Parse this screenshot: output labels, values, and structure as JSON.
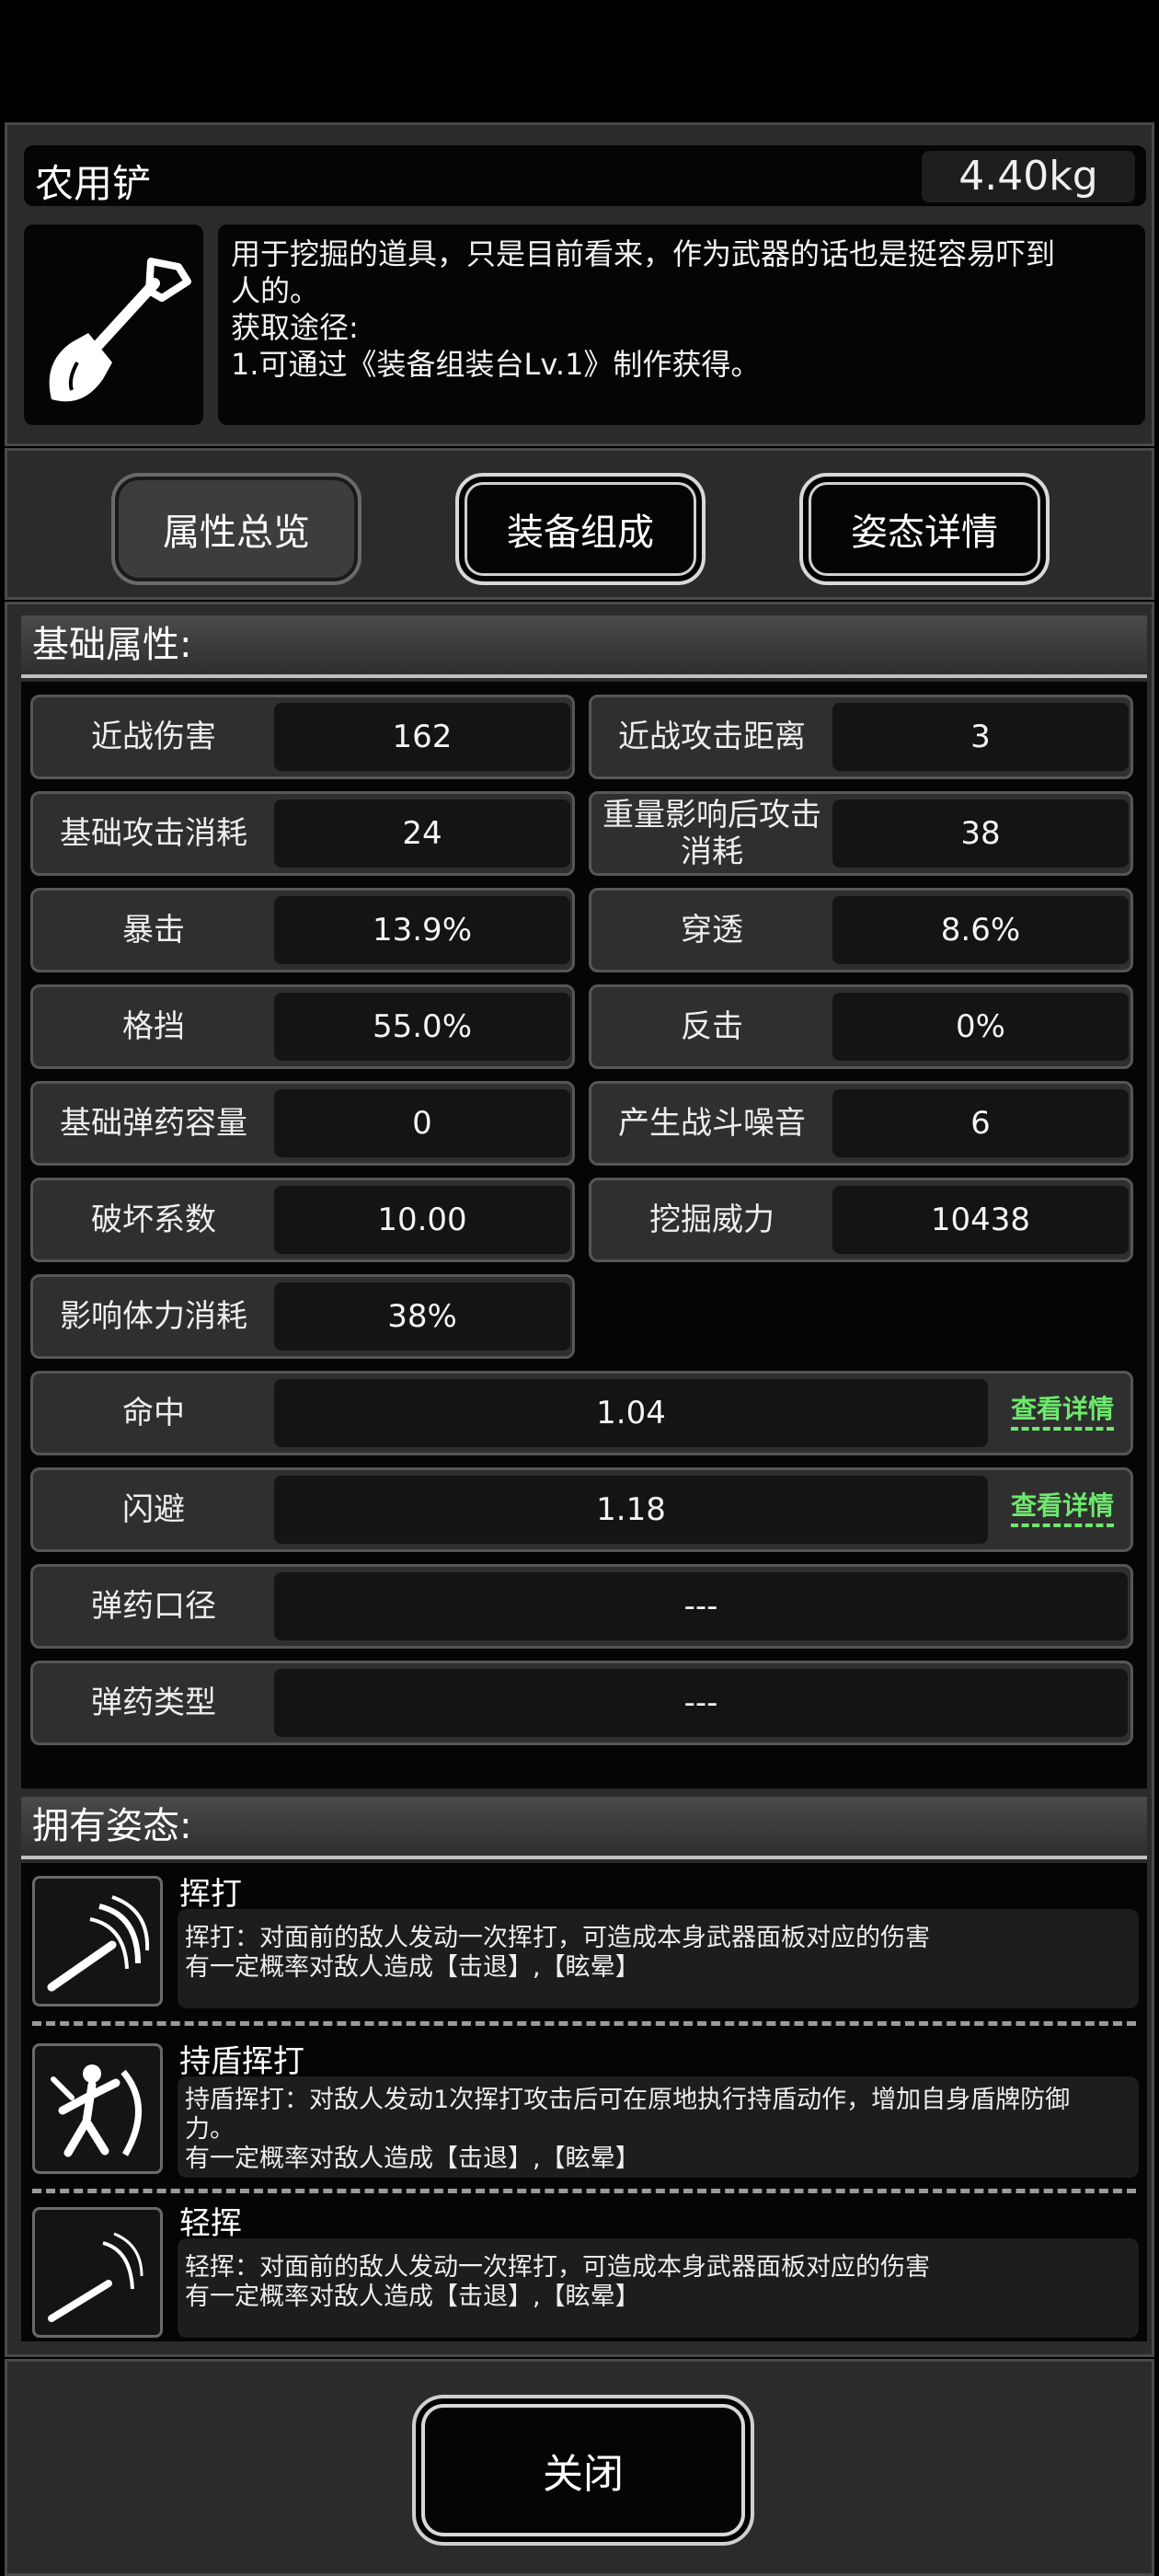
{
  "item": {
    "name": "农用铲",
    "weight": "4.40kg",
    "icon": "shovel-icon",
    "description_lines": [
      "用于挖掘的道具，只是目前看来，作为武器的话也是挺容易吓到",
      "人的。",
      "获取途径:",
      "1.可通过《装备组装台Lv.1》制作获得。"
    ]
  },
  "tabs": [
    {
      "label": "属性总览",
      "active": true
    },
    {
      "label": "装备组成",
      "active": false
    },
    {
      "label": "姿态详情",
      "active": false
    }
  ],
  "base_stats": {
    "heading": "基础属性:",
    "grid": [
      {
        "label": "近战伤害",
        "value": "162"
      },
      {
        "label": "近战攻击距离",
        "value": "3"
      },
      {
        "label": "基础攻击消耗",
        "value": "24"
      },
      {
        "label": "重量影响后攻击消耗",
        "value": "38"
      },
      {
        "label": "暴击",
        "value": "13.9%"
      },
      {
        "label": "穿透",
        "value": "8.6%"
      },
      {
        "label": "格挡",
        "value": "55.0%"
      },
      {
        "label": "反击",
        "value": "0%"
      },
      {
        "label": "基础弹药容量",
        "value": "0"
      },
      {
        "label": "产生战斗噪音",
        "value": "6"
      },
      {
        "label": "破坏系数",
        "value": "10.00"
      },
      {
        "label": "挖掘威力",
        "value": "10438"
      },
      {
        "label": "影响体力消耗",
        "value": "38%"
      }
    ],
    "wide": [
      {
        "label": "命中",
        "value": "1.04",
        "link": "查看详情"
      },
      {
        "label": "闪避",
        "value": "1.18",
        "link": "查看详情"
      },
      {
        "label": "弹药口径",
        "value": "---"
      },
      {
        "label": "弹药类型",
        "value": "---"
      }
    ]
  },
  "poses": {
    "heading": "拥有姿态:",
    "items": [
      {
        "name": "挥打",
        "icon": "swing-icon",
        "lines": [
          "挥打：对面前的敌人发动一次挥打，可造成本身武器面板对应的伤害",
          "有一定概率对敌人造成【击退】,【眩晕】"
        ]
      },
      {
        "name": "持盾挥打",
        "icon": "shield-swing-icon",
        "lines": [
          "持盾挥打：对敌人发动1次挥打攻击后可在原地执行持盾动作，增加自身盾牌防御",
          "力。",
          "有一定概率对敌人造成【击退】,【眩晕】"
        ]
      },
      {
        "name": "轻挥",
        "icon": "light-swing-icon",
        "lines": [
          "轻挥：对面前的敌人发动一次挥打，可造成本身武器面板对应的伤害",
          "有一定概率对敌人造成【击退】,【眩晕】"
        ]
      }
    ]
  },
  "footer": {
    "close_label": "关闭"
  }
}
